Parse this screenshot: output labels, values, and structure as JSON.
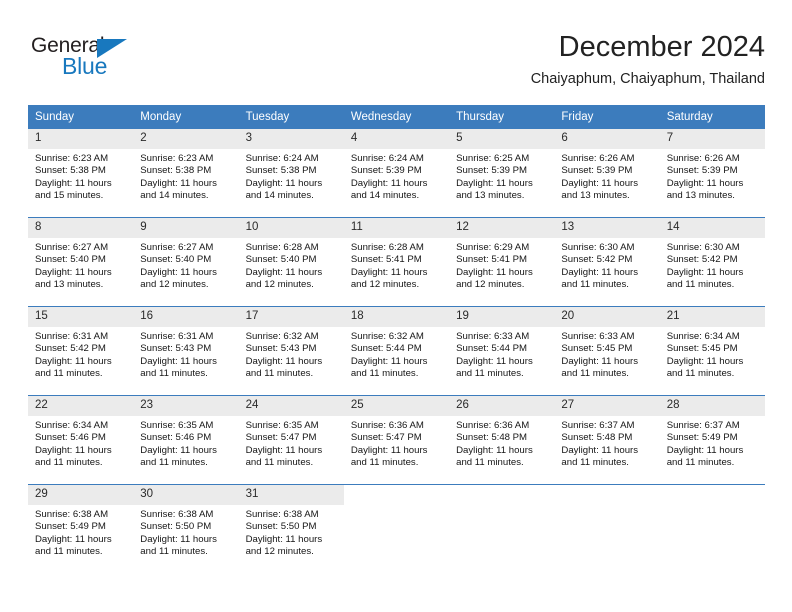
{
  "brand": {
    "name_part1": "General",
    "name_part2": "Blue",
    "triangle_icon": "blue-triangle-icon",
    "accent_color": "#1878be"
  },
  "header": {
    "title": "December 2024",
    "subtitle": "Chaiyaphum, Chaiyaphum, Thailand"
  },
  "theme": {
    "header_bg": "#3c7cbd",
    "daynum_bg": "#ebebeb",
    "row_border": "#3c7cbd",
    "text": "#161616"
  },
  "weekdays": [
    "Sunday",
    "Monday",
    "Tuesday",
    "Wednesday",
    "Thursday",
    "Friday",
    "Saturday"
  ],
  "weeks": [
    [
      {
        "day": "1",
        "sunrise": "Sunrise: 6:23 AM",
        "sunset": "Sunset: 5:38 PM",
        "daylight_line1": "Daylight: 11 hours",
        "daylight_line2": "and 15 minutes."
      },
      {
        "day": "2",
        "sunrise": "Sunrise: 6:23 AM",
        "sunset": "Sunset: 5:38 PM",
        "daylight_line1": "Daylight: 11 hours",
        "daylight_line2": "and 14 minutes."
      },
      {
        "day": "3",
        "sunrise": "Sunrise: 6:24 AM",
        "sunset": "Sunset: 5:38 PM",
        "daylight_line1": "Daylight: 11 hours",
        "daylight_line2": "and 14 minutes."
      },
      {
        "day": "4",
        "sunrise": "Sunrise: 6:24 AM",
        "sunset": "Sunset: 5:39 PM",
        "daylight_line1": "Daylight: 11 hours",
        "daylight_line2": "and 14 minutes."
      },
      {
        "day": "5",
        "sunrise": "Sunrise: 6:25 AM",
        "sunset": "Sunset: 5:39 PM",
        "daylight_line1": "Daylight: 11 hours",
        "daylight_line2": "and 13 minutes."
      },
      {
        "day": "6",
        "sunrise": "Sunrise: 6:26 AM",
        "sunset": "Sunset: 5:39 PM",
        "daylight_line1": "Daylight: 11 hours",
        "daylight_line2": "and 13 minutes."
      },
      {
        "day": "7",
        "sunrise": "Sunrise: 6:26 AM",
        "sunset": "Sunset: 5:39 PM",
        "daylight_line1": "Daylight: 11 hours",
        "daylight_line2": "and 13 minutes."
      }
    ],
    [
      {
        "day": "8",
        "sunrise": "Sunrise: 6:27 AM",
        "sunset": "Sunset: 5:40 PM",
        "daylight_line1": "Daylight: 11 hours",
        "daylight_line2": "and 13 minutes."
      },
      {
        "day": "9",
        "sunrise": "Sunrise: 6:27 AM",
        "sunset": "Sunset: 5:40 PM",
        "daylight_line1": "Daylight: 11 hours",
        "daylight_line2": "and 12 minutes."
      },
      {
        "day": "10",
        "sunrise": "Sunrise: 6:28 AM",
        "sunset": "Sunset: 5:40 PM",
        "daylight_line1": "Daylight: 11 hours",
        "daylight_line2": "and 12 minutes."
      },
      {
        "day": "11",
        "sunrise": "Sunrise: 6:28 AM",
        "sunset": "Sunset: 5:41 PM",
        "daylight_line1": "Daylight: 11 hours",
        "daylight_line2": "and 12 minutes."
      },
      {
        "day": "12",
        "sunrise": "Sunrise: 6:29 AM",
        "sunset": "Sunset: 5:41 PM",
        "daylight_line1": "Daylight: 11 hours",
        "daylight_line2": "and 12 minutes."
      },
      {
        "day": "13",
        "sunrise": "Sunrise: 6:30 AM",
        "sunset": "Sunset: 5:42 PM",
        "daylight_line1": "Daylight: 11 hours",
        "daylight_line2": "and 11 minutes."
      },
      {
        "day": "14",
        "sunrise": "Sunrise: 6:30 AM",
        "sunset": "Sunset: 5:42 PM",
        "daylight_line1": "Daylight: 11 hours",
        "daylight_line2": "and 11 minutes."
      }
    ],
    [
      {
        "day": "15",
        "sunrise": "Sunrise: 6:31 AM",
        "sunset": "Sunset: 5:42 PM",
        "daylight_line1": "Daylight: 11 hours",
        "daylight_line2": "and 11 minutes."
      },
      {
        "day": "16",
        "sunrise": "Sunrise: 6:31 AM",
        "sunset": "Sunset: 5:43 PM",
        "daylight_line1": "Daylight: 11 hours",
        "daylight_line2": "and 11 minutes."
      },
      {
        "day": "17",
        "sunrise": "Sunrise: 6:32 AM",
        "sunset": "Sunset: 5:43 PM",
        "daylight_line1": "Daylight: 11 hours",
        "daylight_line2": "and 11 minutes."
      },
      {
        "day": "18",
        "sunrise": "Sunrise: 6:32 AM",
        "sunset": "Sunset: 5:44 PM",
        "daylight_line1": "Daylight: 11 hours",
        "daylight_line2": "and 11 minutes."
      },
      {
        "day": "19",
        "sunrise": "Sunrise: 6:33 AM",
        "sunset": "Sunset: 5:44 PM",
        "daylight_line1": "Daylight: 11 hours",
        "daylight_line2": "and 11 minutes."
      },
      {
        "day": "20",
        "sunrise": "Sunrise: 6:33 AM",
        "sunset": "Sunset: 5:45 PM",
        "daylight_line1": "Daylight: 11 hours",
        "daylight_line2": "and 11 minutes."
      },
      {
        "day": "21",
        "sunrise": "Sunrise: 6:34 AM",
        "sunset": "Sunset: 5:45 PM",
        "daylight_line1": "Daylight: 11 hours",
        "daylight_line2": "and 11 minutes."
      }
    ],
    [
      {
        "day": "22",
        "sunrise": "Sunrise: 6:34 AM",
        "sunset": "Sunset: 5:46 PM",
        "daylight_line1": "Daylight: 11 hours",
        "daylight_line2": "and 11 minutes."
      },
      {
        "day": "23",
        "sunrise": "Sunrise: 6:35 AM",
        "sunset": "Sunset: 5:46 PM",
        "daylight_line1": "Daylight: 11 hours",
        "daylight_line2": "and 11 minutes."
      },
      {
        "day": "24",
        "sunrise": "Sunrise: 6:35 AM",
        "sunset": "Sunset: 5:47 PM",
        "daylight_line1": "Daylight: 11 hours",
        "daylight_line2": "and 11 minutes."
      },
      {
        "day": "25",
        "sunrise": "Sunrise: 6:36 AM",
        "sunset": "Sunset: 5:47 PM",
        "daylight_line1": "Daylight: 11 hours",
        "daylight_line2": "and 11 minutes."
      },
      {
        "day": "26",
        "sunrise": "Sunrise: 6:36 AM",
        "sunset": "Sunset: 5:48 PM",
        "daylight_line1": "Daylight: 11 hours",
        "daylight_line2": "and 11 minutes."
      },
      {
        "day": "27",
        "sunrise": "Sunrise: 6:37 AM",
        "sunset": "Sunset: 5:48 PM",
        "daylight_line1": "Daylight: 11 hours",
        "daylight_line2": "and 11 minutes."
      },
      {
        "day": "28",
        "sunrise": "Sunrise: 6:37 AM",
        "sunset": "Sunset: 5:49 PM",
        "daylight_line1": "Daylight: 11 hours",
        "daylight_line2": "and 11 minutes."
      }
    ],
    [
      {
        "day": "29",
        "sunrise": "Sunrise: 6:38 AM",
        "sunset": "Sunset: 5:49 PM",
        "daylight_line1": "Daylight: 11 hours",
        "daylight_line2": "and 11 minutes."
      },
      {
        "day": "30",
        "sunrise": "Sunrise: 6:38 AM",
        "sunset": "Sunset: 5:50 PM",
        "daylight_line1": "Daylight: 11 hours",
        "daylight_line2": "and 11 minutes."
      },
      {
        "day": "31",
        "sunrise": "Sunrise: 6:38 AM",
        "sunset": "Sunset: 5:50 PM",
        "daylight_line1": "Daylight: 11 hours",
        "daylight_line2": "and 12 minutes."
      },
      {
        "day": "",
        "sunrise": "",
        "sunset": "",
        "daylight_line1": "",
        "daylight_line2": ""
      },
      {
        "day": "",
        "sunrise": "",
        "sunset": "",
        "daylight_line1": "",
        "daylight_line2": ""
      },
      {
        "day": "",
        "sunrise": "",
        "sunset": "",
        "daylight_line1": "",
        "daylight_line2": ""
      },
      {
        "day": "",
        "sunrise": "",
        "sunset": "",
        "daylight_line1": "",
        "daylight_line2": ""
      }
    ]
  ]
}
